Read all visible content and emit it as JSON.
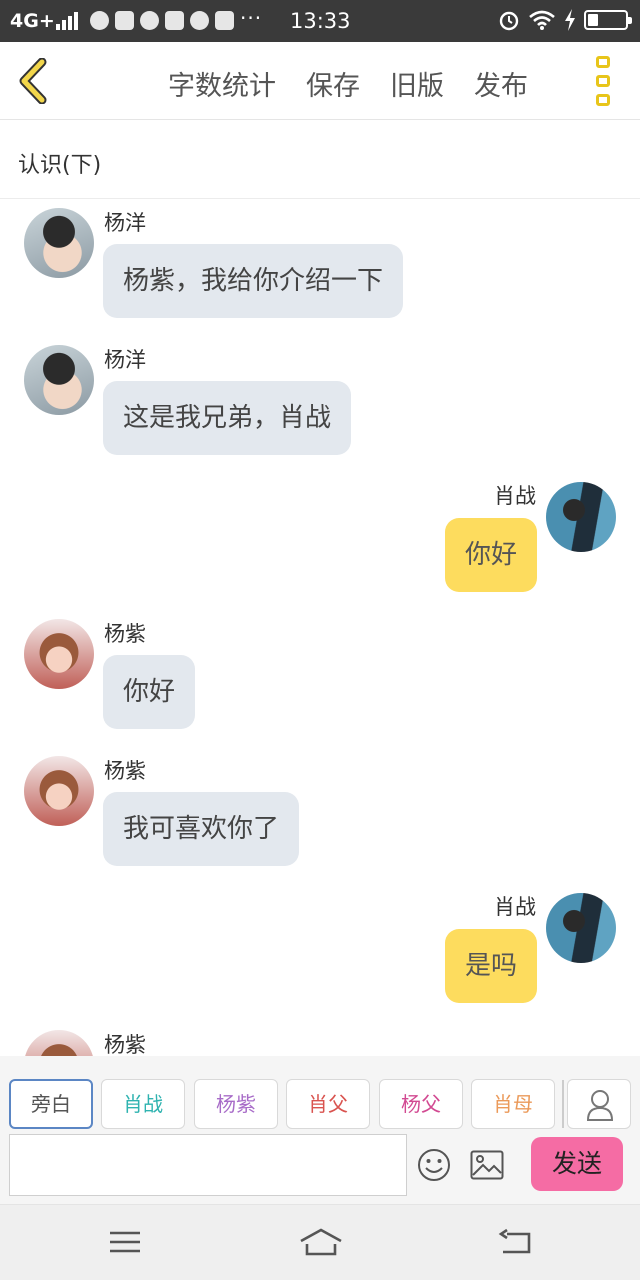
{
  "status_bar": {
    "network": "4G+",
    "dots": "···",
    "time": "13:33"
  },
  "toolbar": {
    "actions": [
      "字数统计",
      "保存",
      "旧版",
      "发布"
    ]
  },
  "chapter_title": "认识(下)",
  "messages": [
    {
      "side": "left",
      "name": "杨洋",
      "text": "杨紫，我给你介绍一下",
      "avatar": "yangyang"
    },
    {
      "side": "left",
      "name": "杨洋",
      "text": "这是我兄弟，肖战",
      "avatar": "yangyang"
    },
    {
      "side": "right",
      "name": "肖战",
      "text": "你好",
      "avatar": "xiaozhan"
    },
    {
      "side": "left",
      "name": "杨紫",
      "text": "你好",
      "avatar": "yangzi"
    },
    {
      "side": "left",
      "name": "杨紫",
      "text": "我可喜欢你了",
      "avatar": "yangzi"
    },
    {
      "side": "right",
      "name": "肖战",
      "text": "是吗",
      "avatar": "xiaozhan"
    },
    {
      "side": "left",
      "name": "杨紫",
      "text": "",
      "avatar": "yangzi"
    }
  ],
  "roles": [
    {
      "label": "旁白",
      "color": "#555555",
      "active": true
    },
    {
      "label": "肖战",
      "color": "#2fb3b0",
      "active": false
    },
    {
      "label": "杨紫",
      "color": "#a86cc8",
      "active": false
    },
    {
      "label": "肖父",
      "color": "#d9534f",
      "active": false
    },
    {
      "label": "杨父",
      "color": "#d24a92",
      "active": false
    },
    {
      "label": "肖母",
      "color": "#eb9a5a",
      "active": false
    }
  ],
  "input": {
    "value": "",
    "send_label": "发送"
  },
  "colors": {
    "accent_yellow": "#e8c51a",
    "bubble_left": "#e3e8ee",
    "bubble_right": "#fddc5e",
    "send_button": "#f56ca4"
  }
}
